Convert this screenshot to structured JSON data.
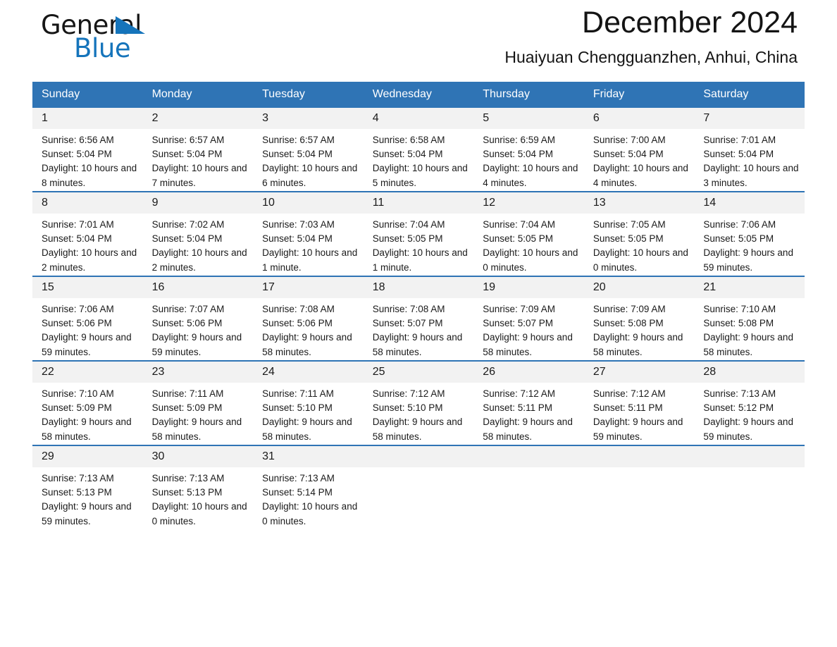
{
  "brand": {
    "name_dark": "General",
    "name_light": "Blue",
    "triangle_color": "#1574bb"
  },
  "header": {
    "title": "December 2024",
    "subtitle": "Huaiyuan Chengguanzhen, Anhui, China",
    "accent_color": "#2f74b5",
    "daynum_background": "#f2f2f2"
  },
  "weekday_headers": [
    "Sunday",
    "Monday",
    "Tuesday",
    "Wednesday",
    "Thursday",
    "Friday",
    "Saturday"
  ],
  "weeks": [
    [
      {
        "day": "1",
        "sunrise": "Sunrise: 6:56 AM",
        "sunset": "Sunset: 5:04 PM",
        "daylight": "Daylight: 10 hours and 8 minutes."
      },
      {
        "day": "2",
        "sunrise": "Sunrise: 6:57 AM",
        "sunset": "Sunset: 5:04 PM",
        "daylight": "Daylight: 10 hours and 7 minutes."
      },
      {
        "day": "3",
        "sunrise": "Sunrise: 6:57 AM",
        "sunset": "Sunset: 5:04 PM",
        "daylight": "Daylight: 10 hours and 6 minutes."
      },
      {
        "day": "4",
        "sunrise": "Sunrise: 6:58 AM",
        "sunset": "Sunset: 5:04 PM",
        "daylight": "Daylight: 10 hours and 5 minutes."
      },
      {
        "day": "5",
        "sunrise": "Sunrise: 6:59 AM",
        "sunset": "Sunset: 5:04 PM",
        "daylight": "Daylight: 10 hours and 4 minutes."
      },
      {
        "day": "6",
        "sunrise": "Sunrise: 7:00 AM",
        "sunset": "Sunset: 5:04 PM",
        "daylight": "Daylight: 10 hours and 4 minutes."
      },
      {
        "day": "7",
        "sunrise": "Sunrise: 7:01 AM",
        "sunset": "Sunset: 5:04 PM",
        "daylight": "Daylight: 10 hours and 3 minutes."
      }
    ],
    [
      {
        "day": "8",
        "sunrise": "Sunrise: 7:01 AM",
        "sunset": "Sunset: 5:04 PM",
        "daylight": "Daylight: 10 hours and 2 minutes."
      },
      {
        "day": "9",
        "sunrise": "Sunrise: 7:02 AM",
        "sunset": "Sunset: 5:04 PM",
        "daylight": "Daylight: 10 hours and 2 minutes."
      },
      {
        "day": "10",
        "sunrise": "Sunrise: 7:03 AM",
        "sunset": "Sunset: 5:04 PM",
        "daylight": "Daylight: 10 hours and 1 minute."
      },
      {
        "day": "11",
        "sunrise": "Sunrise: 7:04 AM",
        "sunset": "Sunset: 5:05 PM",
        "daylight": "Daylight: 10 hours and 1 minute."
      },
      {
        "day": "12",
        "sunrise": "Sunrise: 7:04 AM",
        "sunset": "Sunset: 5:05 PM",
        "daylight": "Daylight: 10 hours and 0 minutes."
      },
      {
        "day": "13",
        "sunrise": "Sunrise: 7:05 AM",
        "sunset": "Sunset: 5:05 PM",
        "daylight": "Daylight: 10 hours and 0 minutes."
      },
      {
        "day": "14",
        "sunrise": "Sunrise: 7:06 AM",
        "sunset": "Sunset: 5:05 PM",
        "daylight": "Daylight: 9 hours and 59 minutes."
      }
    ],
    [
      {
        "day": "15",
        "sunrise": "Sunrise: 7:06 AM",
        "sunset": "Sunset: 5:06 PM",
        "daylight": "Daylight: 9 hours and 59 minutes."
      },
      {
        "day": "16",
        "sunrise": "Sunrise: 7:07 AM",
        "sunset": "Sunset: 5:06 PM",
        "daylight": "Daylight: 9 hours and 59 minutes."
      },
      {
        "day": "17",
        "sunrise": "Sunrise: 7:08 AM",
        "sunset": "Sunset: 5:06 PM",
        "daylight": "Daylight: 9 hours and 58 minutes."
      },
      {
        "day": "18",
        "sunrise": "Sunrise: 7:08 AM",
        "sunset": "Sunset: 5:07 PM",
        "daylight": "Daylight: 9 hours and 58 minutes."
      },
      {
        "day": "19",
        "sunrise": "Sunrise: 7:09 AM",
        "sunset": "Sunset: 5:07 PM",
        "daylight": "Daylight: 9 hours and 58 minutes."
      },
      {
        "day": "20",
        "sunrise": "Sunrise: 7:09 AM",
        "sunset": "Sunset: 5:08 PM",
        "daylight": "Daylight: 9 hours and 58 minutes."
      },
      {
        "day": "21",
        "sunrise": "Sunrise: 7:10 AM",
        "sunset": "Sunset: 5:08 PM",
        "daylight": "Daylight: 9 hours and 58 minutes."
      }
    ],
    [
      {
        "day": "22",
        "sunrise": "Sunrise: 7:10 AM",
        "sunset": "Sunset: 5:09 PM",
        "daylight": "Daylight: 9 hours and 58 minutes."
      },
      {
        "day": "23",
        "sunrise": "Sunrise: 7:11 AM",
        "sunset": "Sunset: 5:09 PM",
        "daylight": "Daylight: 9 hours and 58 minutes."
      },
      {
        "day": "24",
        "sunrise": "Sunrise: 7:11 AM",
        "sunset": "Sunset: 5:10 PM",
        "daylight": "Daylight: 9 hours and 58 minutes."
      },
      {
        "day": "25",
        "sunrise": "Sunrise: 7:12 AM",
        "sunset": "Sunset: 5:10 PM",
        "daylight": "Daylight: 9 hours and 58 minutes."
      },
      {
        "day": "26",
        "sunrise": "Sunrise: 7:12 AM",
        "sunset": "Sunset: 5:11 PM",
        "daylight": "Daylight: 9 hours and 58 minutes."
      },
      {
        "day": "27",
        "sunrise": "Sunrise: 7:12 AM",
        "sunset": "Sunset: 5:11 PM",
        "daylight": "Daylight: 9 hours and 59 minutes."
      },
      {
        "day": "28",
        "sunrise": "Sunrise: 7:13 AM",
        "sunset": "Sunset: 5:12 PM",
        "daylight": "Daylight: 9 hours and 59 minutes."
      }
    ],
    [
      {
        "day": "29",
        "sunrise": "Sunrise: 7:13 AM",
        "sunset": "Sunset: 5:13 PM",
        "daylight": "Daylight: 9 hours and 59 minutes."
      },
      {
        "day": "30",
        "sunrise": "Sunrise: 7:13 AM",
        "sunset": "Sunset: 5:13 PM",
        "daylight": "Daylight: 10 hours and 0 minutes."
      },
      {
        "day": "31",
        "sunrise": "Sunrise: 7:13 AM",
        "sunset": "Sunset: 5:14 PM",
        "daylight": "Daylight: 10 hours and 0 minutes."
      },
      {
        "day": "",
        "sunrise": "",
        "sunset": "",
        "daylight": ""
      },
      {
        "day": "",
        "sunrise": "",
        "sunset": "",
        "daylight": ""
      },
      {
        "day": "",
        "sunrise": "",
        "sunset": "",
        "daylight": ""
      },
      {
        "day": "",
        "sunrise": "",
        "sunset": "",
        "daylight": ""
      }
    ]
  ]
}
